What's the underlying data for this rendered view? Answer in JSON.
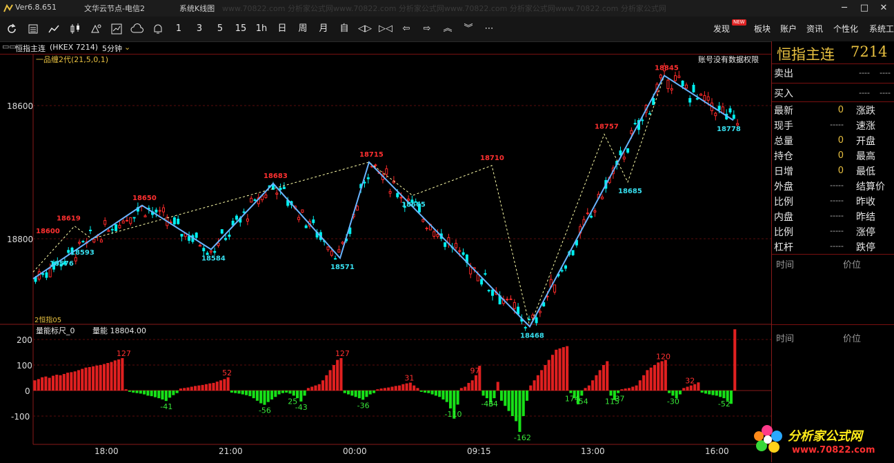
{
  "titlebar": {
    "version": "Ver6.8.651",
    "server": "文华云节点-电信2",
    "menu": "系统K线图",
    "watermark": "www.70822.com 分析家公式网www.70822.com 分析家公式网www.70822.com 分析家公式网www.70822.com 分析家公式网"
  },
  "toolbar": {
    "periods": [
      "1",
      "3",
      "5",
      "15",
      "1h",
      "日",
      "周",
      "月",
      "自"
    ],
    "right_menu": [
      "发现",
      "板块",
      "账户",
      "资讯",
      "个性化",
      "系统工"
    ],
    "new_badge": "NEW"
  },
  "infobar": {
    "symbol": "恒指主连",
    "code": "(HKEX 7214)",
    "period": "5分钟"
  },
  "price_chart": {
    "indicator": "一品缠2代(21,5,0,1)",
    "notice": "账号没有数据权限",
    "sub_label": "2恒指05",
    "up_color": "#ff2a2a",
    "down_color": "#00f0f0",
    "zigzag_color": "#6ab4ff"
  },
  "volume_chart": {
    "indicator": "量能标尺_0",
    "value_label": "量能 18804.00",
    "pos_color": "#e02020",
    "neg_color": "#18e018"
  },
  "chart_data": [
    {
      "type": "candlestick",
      "title": "一品缠2代(21,5,0,1)",
      "x_ticks": [
        "18:00",
        "21:00",
        "00:00",
        "09:15",
        "13:00",
        "16:00"
      ],
      "y_ticks": [
        18600,
        18800
      ],
      "ylim": [
        18468,
        18890
      ],
      "zigzag": [
        {
          "x": 0,
          "y": 18540
        },
        {
          "x": 158,
          "y": 18650,
          "label": "18650",
          "kind": "high"
        },
        {
          "x": 258,
          "y": 18584,
          "label": "18584",
          "kind": "low"
        },
        {
          "x": 348,
          "y": 18683,
          "label": "18683",
          "kind": "high"
        },
        {
          "x": 445,
          "y": 18571,
          "label": "18571",
          "kind": "low"
        },
        {
          "x": 487,
          "y": 18715,
          "label": "18715",
          "kind": "high"
        },
        {
          "x": 720,
          "y": 18468,
          "label": "18468",
          "kind": "low"
        },
        {
          "x": 915,
          "y": 18845,
          "label": "18845",
          "kind": "high"
        },
        {
          "x": 1015,
          "y": 18778,
          "label": "18778",
          "kind": "low"
        }
      ],
      "dashed_path": [
        {
          "x": 0,
          "y": 18550
        },
        {
          "x": 60,
          "y": 18619
        },
        {
          "x": 85,
          "y": 18600
        },
        {
          "x": 487,
          "y": 18715
        },
        {
          "x": 550,
          "y": 18665
        },
        {
          "x": 665,
          "y": 18710
        },
        {
          "x": 720,
          "y": 18468
        },
        {
          "x": 828,
          "y": 18757
        },
        {
          "x": 862,
          "y": 18685
        },
        {
          "x": 915,
          "y": 18845
        }
      ],
      "labels": [
        {
          "x": 18,
          "y": 18600,
          "text": "18600",
          "kind": "high"
        },
        {
          "x": 48,
          "y": 18619,
          "text": "18619",
          "kind": "high"
        },
        {
          "x": 38,
          "y": 18576,
          "text": "18576",
          "kind": "low"
        },
        {
          "x": 68,
          "y": 18593,
          "text": "18593",
          "kind": "low"
        },
        {
          "x": 158,
          "y": 18650,
          "text": "18650",
          "kind": "high"
        },
        {
          "x": 258,
          "y": 18584,
          "text": "18584",
          "kind": "low"
        },
        {
          "x": 348,
          "y": 18683,
          "text": "18683",
          "kind": "high"
        },
        {
          "x": 445,
          "y": 18571,
          "text": "18571",
          "kind": "low"
        },
        {
          "x": 487,
          "y": 18715,
          "text": "18715",
          "kind": "high"
        },
        {
          "x": 548,
          "y": 18665,
          "text": "18665",
          "kind": "low"
        },
        {
          "x": 662,
          "y": 18710,
          "text": "18710",
          "kind": "high"
        },
        {
          "x": 720,
          "y": 18468,
          "text": "18468",
          "kind": "low"
        },
        {
          "x": 828,
          "y": 18757,
          "text": "18757",
          "kind": "high"
        },
        {
          "x": 862,
          "y": 18685,
          "text": "18685",
          "kind": "low"
        },
        {
          "x": 915,
          "y": 18845,
          "text": "18845",
          "kind": "high"
        },
        {
          "x": 1005,
          "y": 18778,
          "text": "18778",
          "kind": "low"
        }
      ]
    },
    {
      "type": "bar",
      "title": "量能标尺_0",
      "y_ticks": [
        200,
        100,
        0,
        -100
      ],
      "ylim": [
        -200,
        260
      ],
      "values": [
        40,
        45,
        52,
        55,
        50,
        58,
        62,
        60,
        65,
        70,
        72,
        75,
        80,
        85,
        90,
        92,
        95,
        98,
        100,
        104,
        108,
        112,
        118,
        122,
        127,
        5,
        -5,
        -8,
        -10,
        -12,
        -15,
        -20,
        -22,
        -26,
        -30,
        -35,
        -41,
        -28,
        -18,
        -10,
        8,
        10,
        12,
        15,
        18,
        20,
        22,
        25,
        28,
        30,
        35,
        40,
        45,
        52,
        -8,
        -10,
        -12,
        -15,
        -18,
        -22,
        -30,
        -40,
        -50,
        -56,
        -45,
        -35,
        -25,
        -15,
        -10,
        -8,
        -12,
        -20,
        -30,
        -43,
        -20,
        10,
        15,
        20,
        25,
        40,
        60,
        80,
        100,
        120,
        127,
        -10,
        -15,
        -20,
        -25,
        -30,
        -36,
        -25,
        -15,
        -10,
        5,
        8,
        10,
        12,
        15,
        18,
        20,
        25,
        28,
        31,
        20,
        10,
        -5,
        -8,
        -10,
        -15,
        -20,
        -25,
        -35,
        -45,
        -70,
        -110,
        -55,
        10,
        15,
        30,
        40,
        60,
        97,
        -20,
        -30,
        -46,
        -30,
        34,
        -40,
        -60,
        -80,
        -100,
        -120,
        -162,
        -100,
        -40,
        20,
        40,
        60,
        80,
        100,
        120,
        140,
        160,
        165,
        170,
        174,
        -10,
        -30,
        -54,
        -20,
        10,
        20,
        40,
        60,
        80,
        100,
        115,
        -20,
        -37,
        -10,
        5,
        8,
        10,
        15,
        20,
        40,
        60,
        80,
        90,
        100,
        110,
        115,
        120,
        -10,
        -20,
        -30,
        -15,
        10,
        15,
        20,
        25,
        32,
        -8,
        -12,
        -15,
        -18,
        -20,
        -25,
        -30,
        -40,
        -52,
        240
      ],
      "labels": [
        {
          "i": 24,
          "text": "127"
        },
        {
          "i": 36,
          "text": "-41"
        },
        {
          "i": 53,
          "text": "52"
        },
        {
          "i": 63,
          "text": "-56"
        },
        {
          "i": 73,
          "text": "-43"
        },
        {
          "i": 71,
          "text": "25"
        },
        {
          "i": 84,
          "text": "127"
        },
        {
          "i": 90,
          "text": "-36"
        },
        {
          "i": 103,
          "text": "31"
        },
        {
          "i": 114,
          "text": "-110"
        },
        {
          "i": 121,
          "text": "97"
        },
        {
          "i": 124,
          "text": "-46"
        },
        {
          "i": 126,
          "text": "34"
        },
        {
          "i": 133,
          "text": "-162"
        },
        {
          "i": 147,
          "text": "174"
        },
        {
          "i": 150,
          "text": "-54"
        },
        {
          "i": 158,
          "text": "115"
        },
        {
          "i": 160,
          "text": "-37"
        },
        {
          "i": 172,
          "text": "120"
        },
        {
          "i": 175,
          "text": "-30"
        },
        {
          "i": 180,
          "text": "32"
        },
        {
          "i": 189,
          "text": "-52"
        }
      ]
    }
  ],
  "quote_panel": {
    "title": "恒指主连",
    "code": "7214",
    "sell": {
      "label": "卖出",
      "value": "----",
      "volume": "----"
    },
    "buy": {
      "label": "买入",
      "value": "----",
      "volume": "----"
    },
    "rows": [
      {
        "left": "最新",
        "value": "0",
        "right": "涨跌"
      },
      {
        "left": "现手",
        "value": "-----",
        "right": "速涨"
      },
      {
        "left": "总量",
        "value": "0",
        "right": "开盘"
      },
      {
        "left": "持仓",
        "value": "0",
        "right": "最高"
      },
      {
        "left": "日增",
        "value": "0",
        "right": "最低"
      },
      {
        "left": "外盘",
        "value": "-----",
        "right": "结算价"
      },
      {
        "left": "比例",
        "value": "-----",
        "right": "昨收"
      },
      {
        "left": "内盘",
        "value": "-----",
        "right": "昨结"
      },
      {
        "left": "比例",
        "value": "-----",
        "right": "涨停"
      },
      {
        "left": "杠杆",
        "value": "-----",
        "right": "跌停"
      }
    ],
    "ticks_header": {
      "time": "时间",
      "price": "价位"
    },
    "ticks_header2": {
      "time": "时间",
      "price": "价位"
    }
  },
  "logo": {
    "text": "分析家公式网",
    "url": "www.70822.com"
  }
}
